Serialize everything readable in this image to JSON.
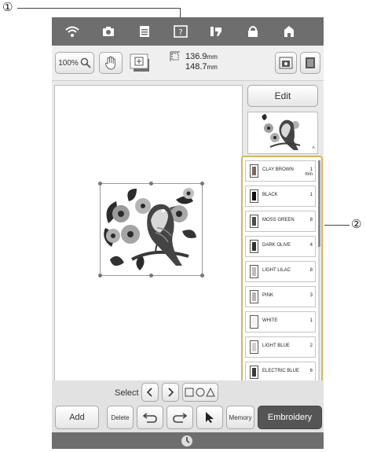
{
  "callouts": {
    "one": "①",
    "two": "②"
  },
  "toolbar": {
    "zoom_label": "100%",
    "size_width": "136.9",
    "size_height": "148.7",
    "unit": "mm"
  },
  "right_panel": {
    "edit_label": "Edit"
  },
  "thread_colors": [
    {
      "name": "CLAY BROWN",
      "count": "1",
      "count_sub": "min",
      "color": "#7a6a5a"
    },
    {
      "name": "BLACK",
      "count": "1",
      "count_sub": "",
      "color": "#111111"
    },
    {
      "name": "MOSS GREEN",
      "count": "8",
      "count_sub": "",
      "color": "#4c4c44"
    },
    {
      "name": "DARK OLIVE",
      "count": "4",
      "count_sub": "",
      "color": "#2f3229"
    },
    {
      "name": "LIGHT LILAC",
      "count": "8",
      "count_sub": "",
      "color": "#bdbdbd"
    },
    {
      "name": "PINK",
      "count": "3",
      "count_sub": "",
      "color": "#b5b5b5"
    },
    {
      "name": "WHITE",
      "count": "1",
      "count_sub": "",
      "color": "#f4f4f4"
    },
    {
      "name": "LIGHT BLUE",
      "count": "2",
      "count_sub": "",
      "color": "#cfcfcf"
    },
    {
      "name": "ELECTRIC BLUE",
      "count": "6",
      "count_sub": "",
      "color": "#3a3a3a"
    }
  ],
  "bottom": {
    "select_label": "Select",
    "add_label": "Add",
    "delete_label": "Delete",
    "memory_label": "Memory",
    "embroidery_label": "Embroidery"
  },
  "colors": {
    "status_bar": "#6e6e6e",
    "callout_border": "#d6b65a",
    "embroidery_active": "#555555"
  }
}
